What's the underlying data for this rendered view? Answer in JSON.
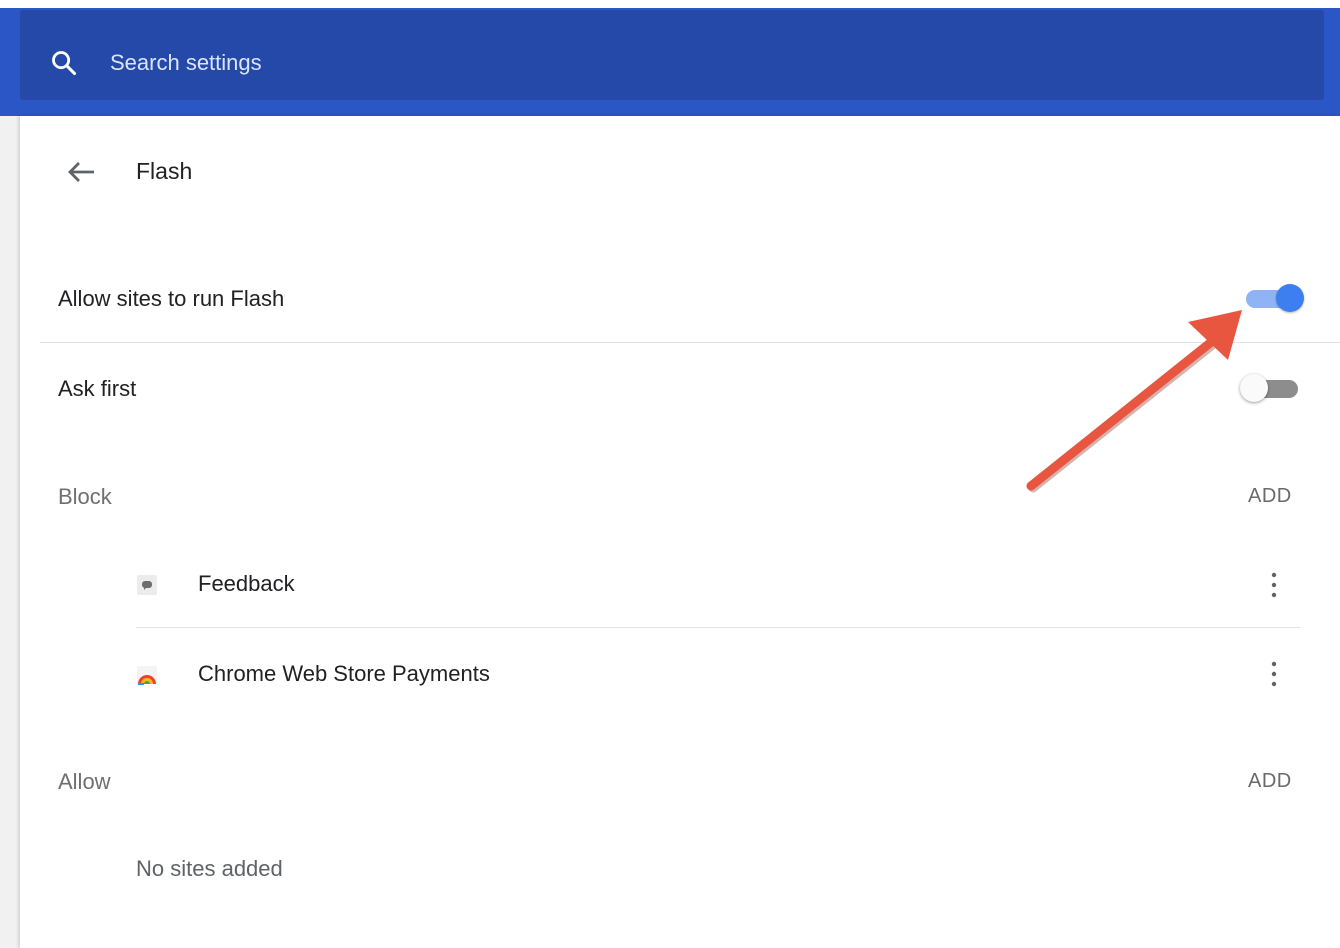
{
  "search": {
    "placeholder": "Search settings",
    "value": ""
  },
  "page": {
    "title": "Flash"
  },
  "settings": {
    "allow_flash_label": "Allow sites to run Flash",
    "allow_flash_on": true,
    "ask_first_label": "Ask first",
    "ask_first_on": false
  },
  "block": {
    "label": "Block",
    "add_label": "ADD",
    "sites": [
      {
        "name": "Feedback",
        "icon": "feedback-icon"
      },
      {
        "name": "Chrome Web Store Payments",
        "icon": "chrome-web-store-icon"
      }
    ]
  },
  "allow": {
    "label": "Allow",
    "add_label": "ADD",
    "empty_text": "No sites added"
  },
  "colors": {
    "header": "#2a56c6",
    "search_bar": "#2449a8",
    "toggle_on": "#3d7ef0",
    "annotation_arrow": "#e8563f"
  }
}
